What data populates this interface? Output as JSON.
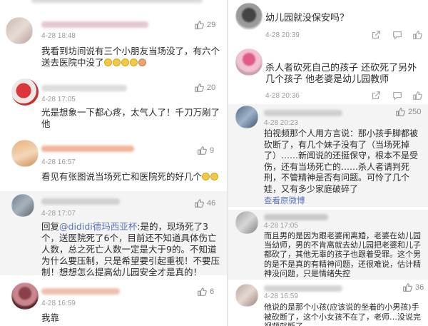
{
  "left_column": {
    "comments": [
      {
        "time": "4-28 18:48",
        "likes": "29",
        "text": "我看到坊间说有三个小朋友当场没了，有六个送去医院中没了"
      },
      {
        "time": "4-28 17:05",
        "likes": "20",
        "text": "光是想象一下都心疼，太气人了！千刀万剐了他"
      },
      {
        "time": "4-28 16:57",
        "likes": "9",
        "text": "看见有张图说当场死亡和医院死的好几个"
      },
      {
        "time": "4-28 17:07",
        "likes": "46",
        "reply_prefix": "回复",
        "mention": "@dididi德玛西亚杯",
        "text": ":是的，现场死了3个，送医院死了6个，目前还不知道具体伤亡人数，总之死亡人数一定是大于9的。不知道为什么要压制，只是希望要引起重视！不要压制！想想怎么提高幼儿园安全才是真的！"
      },
      {
        "time": "4-28 16:59",
        "likes": "6",
        "text": "我靠"
      }
    ]
  },
  "right_column": {
    "comments": [
      {
        "time": "4-28 20:39",
        "text": "幼儿园就没保安吗？"
      },
      {
        "time": "4-28 20:36",
        "text": "杀人者砍死自己的孩子 还砍死了另外几个孩子  他老婆是幼儿园教师"
      },
      {
        "time": "4-28 20:23",
        "likes": "250",
        "text": "拍视频那个人用方言说：那小孩手脚都被砍断了，有几个妹子没有了（当场死掉了）……新闻说的还挺保守，根本不是受伤，还有当场死亡的……杀人者请判死刑，不管精神是否有问题。可怜了几个娃，又有多少家庭破碎了",
        "more": "查看原微博"
      },
      {
        "time": "4-28 17:05",
        "text": "而且男的是因为跟老婆闹离婚，老婆在幼儿园当幼师，男的不肯离就去幼儿园把老婆和儿子都砍了，其他无辜的孩子也跟着受罪。这个男的是不是真的有精神问题，还很难说，估计精神没问题，只是情绪失控"
      },
      {
        "time": "4-28 16:59",
        "likes": "36",
        "text": "他说的是那个小孩(应该说的坐着的小男孩)手被砍断了，这个小女孩不在了，老师…没说完视频就断了"
      }
    ]
  },
  "icons": {
    "like": "thumbs-up-icon",
    "share": "share-icon",
    "comment": "comment-icon"
  },
  "colors": {
    "link": "#5b74b8",
    "time": "#9b9b9b",
    "text": "#2b2b2b"
  }
}
